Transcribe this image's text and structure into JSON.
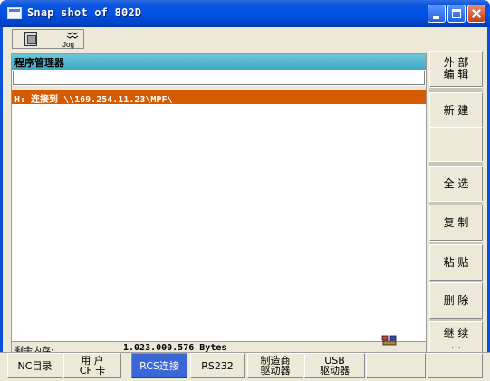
{
  "window": {
    "title": "Snap shot of 802D"
  },
  "toolbar": {
    "jog_label": "Jog"
  },
  "program_manager": {
    "title": "程序管理器",
    "path_input_value": "",
    "rows": [
      "H: 连接到 \\\\169.254.11.23\\MPF\\"
    ]
  },
  "status": {
    "memory_label": "剩余内存:",
    "memory_value": "1.023.000.576 Bytes"
  },
  "softkeys_right": [
    "外 部\n编 辑",
    "新 建",
    "",
    "全 选",
    "复 制",
    "粘 贴",
    "删 除",
    "继 续\n..."
  ],
  "softkeys_bottom": [
    "NC目录",
    "用 户\nCF 卡",
    "RCS连接",
    "RS232",
    "制造商\n驱动器",
    "USB\n驱动器",
    "",
    ""
  ],
  "colors": {
    "accent_header": "#3ea8c6",
    "selected_row": "#d65a00",
    "active_softkey": "#3a66d6"
  },
  "icons": [
    "app-window-icon",
    "panel-icon",
    "jog-icon",
    "network-icon"
  ]
}
